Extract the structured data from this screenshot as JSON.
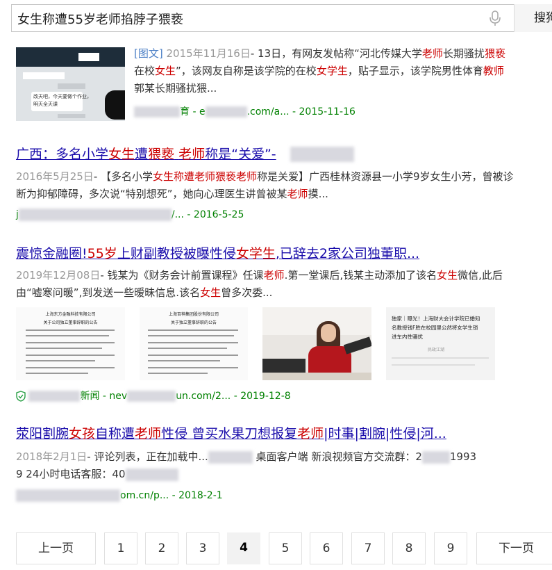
{
  "search": {
    "query": "女生称遭55岁老师掐脖子猥亵",
    "button_label": "搜狗"
  },
  "results": [
    {
      "snippet_tag": "[图文]",
      "date": "2015年11月16日",
      "snippet": [
        {
          "t": "- 13日，有网友发帖称“河北传媒大学"
        },
        {
          "t": "老师",
          "h": true
        },
        {
          "t": "长期骚扰"
        },
        {
          "t": "猥亵",
          "h": true
        },
        {
          "t": "在校"
        },
        {
          "t": "女生",
          "h": true
        },
        {
          "t": "”，该网友自称是该学院的在校"
        },
        {
          "t": "女学生",
          "h": true
        },
        {
          "t": "，贴子显示，该学院男性体育"
        },
        {
          "t": "教师",
          "h": true
        },
        {
          "t": "郭某长期骚扰猥..."
        }
      ],
      "url_pre": "育 - e",
      "url_post": ".com/a... - 2015-11-16",
      "thumb_text": [
        "改天吧，今天要做个作业，",
        "明天全天课"
      ]
    },
    {
      "title": [
        {
          "t": "广西：多名小学"
        },
        {
          "t": "女生",
          "h": true
        },
        {
          "t": "遭"
        },
        {
          "t": "猥亵",
          "h": true
        },
        {
          "t": " "
        },
        {
          "t": "老师",
          "h": true
        },
        {
          "t": "称是“关爱”-"
        }
      ],
      "date": "2016年5月25日",
      "snippet": [
        {
          "t": "- 【多名小学"
        },
        {
          "t": "女生称遭老师猥亵老师",
          "h": true
        },
        {
          "t": "称是关爱】广西桂林资源县一小学9岁女生小芳，曾被诊断为抑郁障碍，多次说“特别想死”，她向心理医生讲曾被某"
        },
        {
          "t": "老师",
          "h": true
        },
        {
          "t": "摸..."
        }
      ],
      "url_pre": "j",
      "url_post": "/... - 2016-5-25"
    },
    {
      "title": [
        {
          "t": "震惊金融圈!"
        },
        {
          "t": "55岁",
          "h": true
        },
        {
          "t": "上财副教授被曝性侵"
        },
        {
          "t": "女学生",
          "h": true
        },
        {
          "t": ",已辞去2家公司独董职..."
        }
      ],
      "date": "2019年12月08日",
      "snippet": [
        {
          "t": "- 钱某为《财务会计前置课程》任课"
        },
        {
          "t": "老师",
          "h": true
        },
        {
          "t": ".第一堂课后,钱某主动添加了该名"
        },
        {
          "t": "女生",
          "h": true
        },
        {
          "t": "微信,此后由“嘘寒问暖”,到发送一些暧昧信息.该名"
        },
        {
          "t": "女生",
          "h": true
        },
        {
          "t": "曾多次委..."
        }
      ],
      "images": [
        {
          "head": "上海东方金融科技有限公司",
          "sub": "关于公司独立董事辞职的公告"
        },
        {
          "head": "上海百神集团股份有限公司",
          "sub": "关于独立董事辞职的公告"
        },
        {
          "photo": true
        },
        {
          "caption_lines": [
            "独家｜曝光！上海财大会计学院已婚知",
            "名教授钱F胜在校园里公然将女学生锁",
            "进车内性骚扰"
          ],
          "caption_meta": "民政江湖"
        }
      ],
      "url_pre": "",
      "url_mid": "新闻 - nev",
      "url_post": "un.com/2... - 2019-12-8"
    },
    {
      "title": [
        {
          "t": "荥阳割腕"
        },
        {
          "t": "女孩",
          "h": true
        },
        {
          "t": "自称遭"
        },
        {
          "t": "老师",
          "h": true
        },
        {
          "t": "性侵 曾买水果刀想报复"
        },
        {
          "t": "老师",
          "h": true
        },
        {
          "t": "|时事|割腕|性侵|河..."
        }
      ],
      "date": "2018年2月1日",
      "snippet_a": "- 评论列表，正在加载中...",
      "snippet_b": "桌面客户端 新浪视频官方交流群：2",
      "snippet_c": "1993",
      "snippet_d": "9 24小时电话客服：40",
      "url_post": "om.cn/p... - 2018-2-1"
    }
  ],
  "pagination": {
    "prev": "上一页",
    "pages": [
      "1",
      "2",
      "3",
      "4",
      "5",
      "6",
      "7",
      "8",
      "9"
    ],
    "current": "4",
    "next": "下一页"
  }
}
